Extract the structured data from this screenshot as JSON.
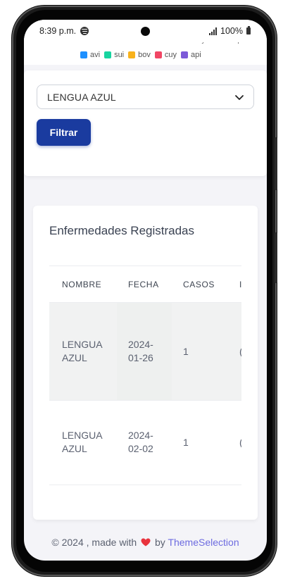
{
  "status_bar": {
    "time": "8:39 p.m.",
    "battery": "100%"
  },
  "chart_remnant": {
    "cutoff_labels": [
      "avi",
      "sui",
      "bov",
      "cuy",
      "api"
    ],
    "legend": [
      {
        "label": "avi",
        "color": "#1e90ff"
      },
      {
        "label": "sui",
        "color": "#17d4a0"
      },
      {
        "label": "bov",
        "color": "#f8b21c"
      },
      {
        "label": "cuy",
        "color": "#f14664"
      },
      {
        "label": "api",
        "color": "#7c5ad8"
      }
    ]
  },
  "filter": {
    "selected_value": "LENGUA AZUL",
    "button_label": "Filtrar"
  },
  "table": {
    "title": "Enfermedades Registradas",
    "headers": [
      "NOMBRE",
      "FECHA",
      "CASOS",
      "I"
    ],
    "rows": [
      {
        "nombre": "LENGUA AZUL",
        "fecha": "2024-01-26",
        "casos": "1",
        "extra": "("
      },
      {
        "nombre": "LENGUA AZUL",
        "fecha": "2024-02-02",
        "casos": "1",
        "extra": "("
      }
    ]
  },
  "footer": {
    "prefix": "© 2024 , made with",
    "by": "by",
    "link": "ThemeSelection"
  },
  "colors": {
    "primary": "#1a3b9f",
    "link": "#6d6be0",
    "heart": "#e8333d"
  }
}
